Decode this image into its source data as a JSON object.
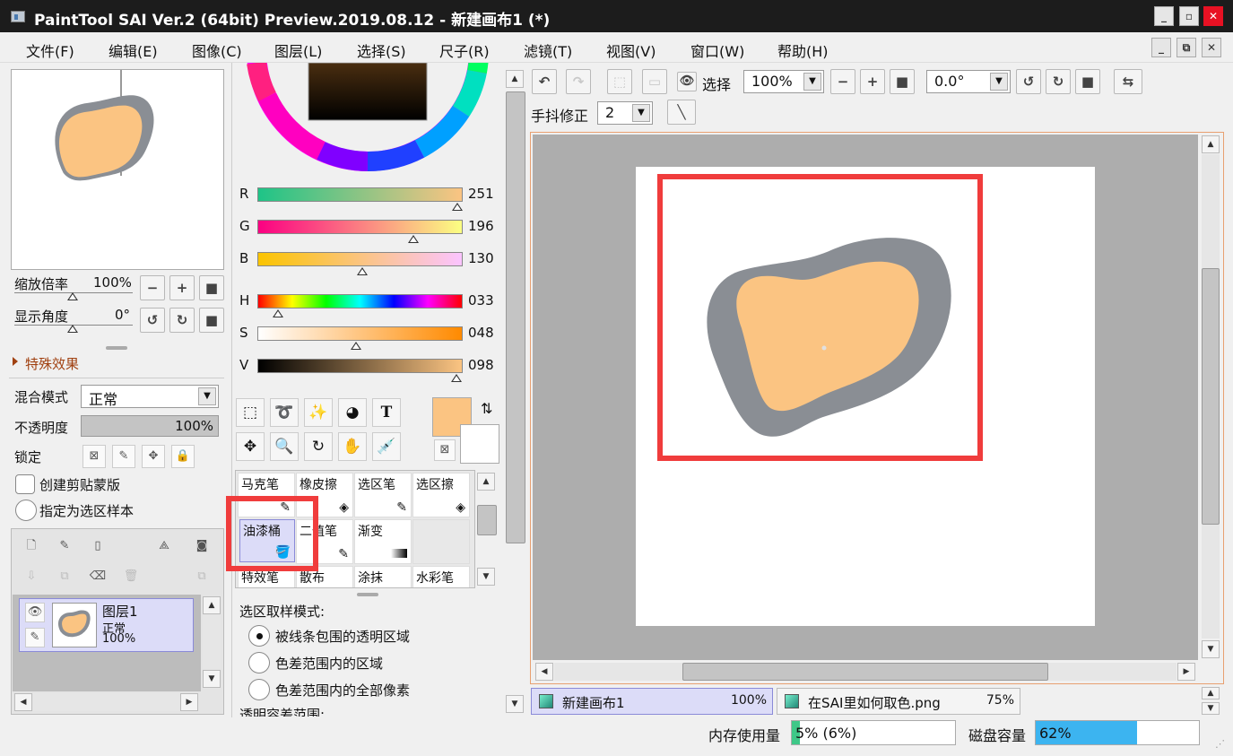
{
  "window": {
    "title": "PaintTool SAI Ver.2 (64bit) Preview.2019.08.12 - 新建画布1 (*)"
  },
  "menu": [
    "文件(F)",
    "编辑(E)",
    "图像(C)",
    "图层(L)",
    "选择(S)",
    "尺子(R)",
    "滤镜(T)",
    "视图(V)",
    "窗口(W)",
    "帮助(H)"
  ],
  "navigator": {
    "zoom_label": "缩放倍率",
    "zoom_value": "100%",
    "angle_label": "显示角度",
    "angle_value": "0°"
  },
  "effects": {
    "label": "特殊效果"
  },
  "layer_props": {
    "blend_label": "混合模式",
    "blend_value": "正常",
    "opacity_label": "不透明度",
    "opacity_value": "100%",
    "lock_label": "锁定",
    "clip_label": "创建剪贴蒙版",
    "sample_label": "指定为选区样本"
  },
  "layer": {
    "name": "图层1",
    "mode": "正常",
    "opacity": "100%"
  },
  "color_sliders": [
    {
      "label": "R",
      "value": "251",
      "pos": 0.984
    },
    {
      "label": "G",
      "value": "196",
      "pos": 0.768
    },
    {
      "label": "B",
      "value": "130",
      "pos": 0.51
    },
    {
      "label": "H",
      "value": "033",
      "pos": 0.09
    },
    {
      "label": "S",
      "value": "048",
      "pos": 0.48
    },
    {
      "label": "V",
      "value": "098",
      "pos": 0.98
    }
  ],
  "colors": {
    "primary": "#fbc482",
    "secondary": "#ffffff",
    "outline": "#8a8e94",
    "highlight": "#f03c3c"
  },
  "text_tool": "T",
  "brushes": [
    {
      "name": "马克笔",
      "icon": "✎"
    },
    {
      "name": "橡皮擦",
      "icon": "◈"
    },
    {
      "name": "选区笔",
      "icon": "✎"
    },
    {
      "name": "选区擦",
      "icon": "◈"
    },
    {
      "name": "油漆桶",
      "icon": "🪣",
      "selected": true
    },
    {
      "name": "二值笔",
      "icon": "✎"
    },
    {
      "name": "渐变",
      "icon": "▬"
    },
    {
      "name": "",
      "icon": ""
    },
    {
      "name": "特效笔",
      "icon": ""
    },
    {
      "name": "散布",
      "icon": ""
    },
    {
      "name": "涂抹",
      "icon": ""
    },
    {
      "name": "水彩笔",
      "icon": ""
    }
  ],
  "fill_options": {
    "title": "选区取样模式:",
    "options": [
      "被线条包围的透明区域",
      "色差范围内的区域",
      "色差范围内的全部像素"
    ],
    "selected": 0,
    "next_label": "透明容差范围:"
  },
  "canvas_toolbar": {
    "select_label": "选择",
    "zoom": "100%",
    "angle": "0.0°",
    "stabilizer_label": "手抖修正",
    "stabilizer_value": "2"
  },
  "tabs": [
    {
      "name": "新建画布1",
      "zoom": "100%"
    },
    {
      "name": "在SAI里如何取色.png",
      "zoom": "75%"
    }
  ],
  "status": {
    "memory_label": "内存使用量",
    "memory_value": "5% (6%)",
    "memory_fill": 0.05,
    "disk_label": "磁盘容量",
    "disk_value": "62%",
    "disk_fill": 0.62
  }
}
